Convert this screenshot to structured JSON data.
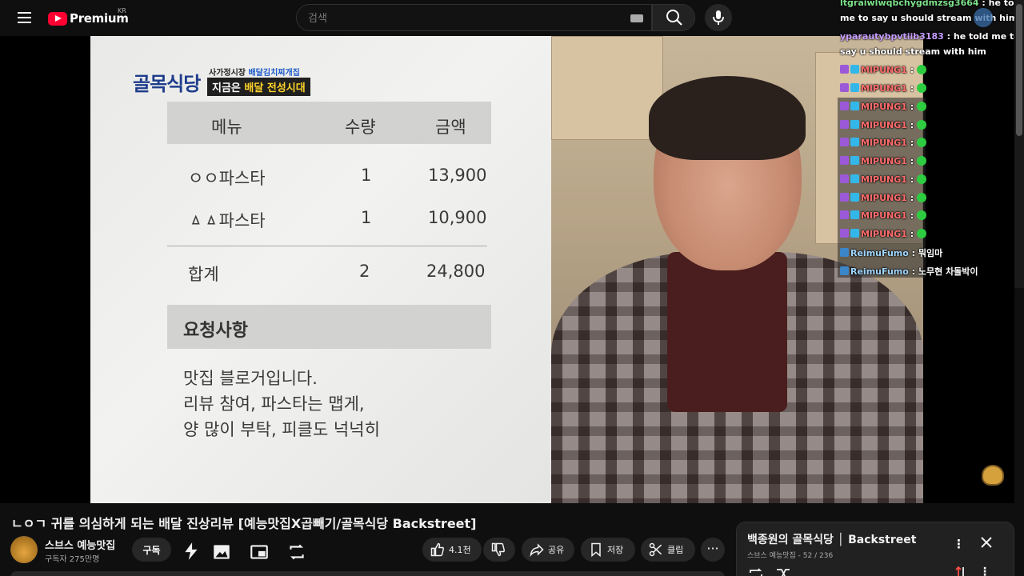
{
  "header": {
    "logo_text": "Premium",
    "region": "KR",
    "search_placeholder": "검색"
  },
  "video_frame": {
    "show_logo": "골목식당",
    "show_sub_1": "사가정시장 ",
    "show_sub_2": "배달김치찌개집",
    "tag_1": "지금은 ",
    "tag_2": "배달 전성시대",
    "table": {
      "headers": [
        "메뉴",
        "수량",
        "금액"
      ],
      "rows": [
        {
          "menu": "ㅇㅇ파스타",
          "qty": "1",
          "price": "13,900"
        },
        {
          "menu": "ㅿㅿ파스타",
          "qty": "1",
          "price": "10,900"
        }
      ],
      "total": {
        "label": "합계",
        "qty": "2",
        "price": "24,800"
      }
    },
    "request_title": "요청사항",
    "request_lines": [
      "맛집 블로거입니다.",
      "리뷰 참여, 파스타는 맵게,",
      "양 많이 부탁, 피클도 넉넉히"
    ]
  },
  "chat": [
    {
      "user": "ltgraiwlwqbchygdmzsg3664",
      "sep": " : ",
      "text": "he told",
      "user_color": "green"
    },
    {
      "user": "",
      "sep": "",
      "text": "me to say u should stream with him",
      "user_color": "green"
    },
    {
      "user": "yparautybpvtiib3183",
      "sep": " : ",
      "text": "he told me to",
      "user_color": "purple"
    },
    {
      "user": "",
      "sep": "",
      "text": "say u should stream with him",
      "user_color": "purple"
    },
    {
      "user": "MIPUNG1",
      "sep": " : ",
      "text": "",
      "user_color": "red"
    },
    {
      "user": "MIPUNG1",
      "sep": " : ",
      "text": "",
      "user_color": "red"
    },
    {
      "user": "MIPUNG1",
      "sep": " : ",
      "text": "",
      "user_color": "red"
    },
    {
      "user": "MIPUNG1",
      "sep": " : ",
      "text": "",
      "user_color": "red"
    },
    {
      "user": "MIPUNG1",
      "sep": " : ",
      "text": "",
      "user_color": "red"
    },
    {
      "user": "MIPUNG1",
      "sep": " : ",
      "text": "",
      "user_color": "red"
    },
    {
      "user": "MIPUNG1",
      "sep": " : ",
      "text": "",
      "user_color": "red"
    },
    {
      "user": "MIPUNG1",
      "sep": " : ",
      "text": "",
      "user_color": "red"
    },
    {
      "user": "MIPUNG1",
      "sep": " : ",
      "text": "",
      "user_color": "red"
    },
    {
      "user": "MIPUNG1",
      "sep": " : ",
      "text": "",
      "user_color": "red"
    },
    {
      "user": "ReimuFumo",
      "sep": " : ",
      "text": "뭐임마",
      "user_color": "blue"
    },
    {
      "user": "ReimuFumo",
      "sep": " : ",
      "text": "노무현 차돌박이",
      "user_color": "blue"
    }
  ],
  "video_info": {
    "title": "ㄴㅇㄱ 귀를 의심하게 되는 배달 진상리뷰 [예능맛집X곱빼기/골목식당 Backstreet]",
    "channel": "스브스 예능맛집",
    "subscribers": "구독자 275만명",
    "subscribe_label": "구독",
    "like_count": "4.1천",
    "share_label": "공유",
    "save_label": "저장",
    "clip_label": "클립",
    "more_label": "···"
  },
  "playlist": {
    "title": "백종원의 골목식당 │ Backstreet",
    "meta": "스브스 예능맛집 - 52 / 236"
  },
  "colors": {
    "bg": "#0f0f0f",
    "brand_red": "#ff0033",
    "show_blue": "#1d3c8c",
    "tag_yellow": "#ffd428"
  }
}
